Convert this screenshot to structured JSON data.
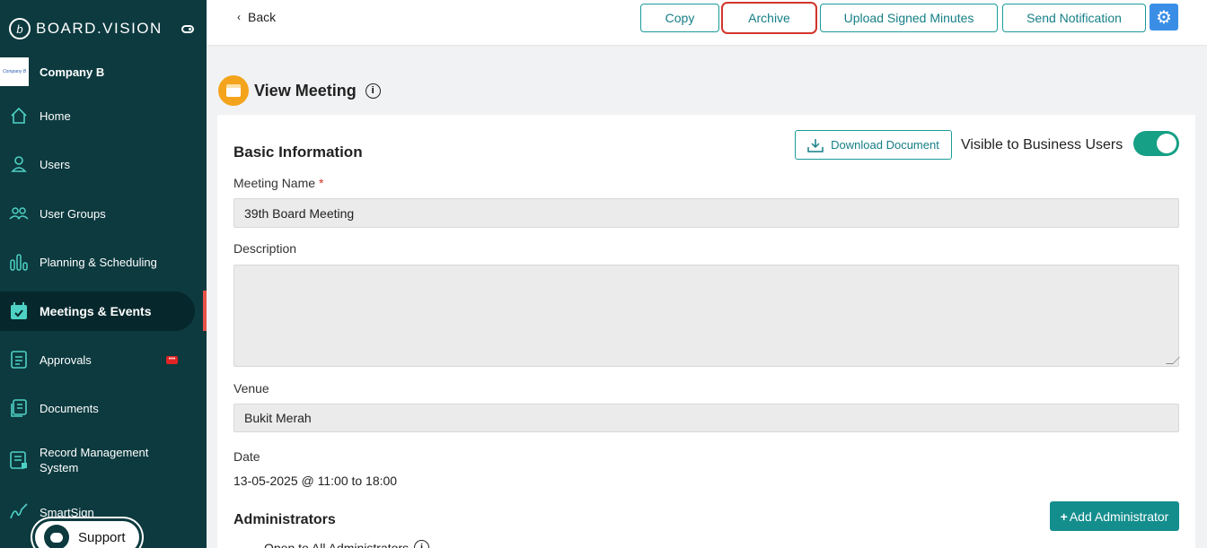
{
  "brand": {
    "name": "BOARD.VISION"
  },
  "company": {
    "logo_text": "Company B",
    "name": "Company B"
  },
  "sidebar": {
    "items": [
      {
        "label": "Home",
        "icon": "home-icon"
      },
      {
        "label": "Users",
        "icon": "user-icon"
      },
      {
        "label": "User Groups",
        "icon": "user-group-icon"
      },
      {
        "label": "Planning & Scheduling",
        "icon": "bar-chart-icon"
      },
      {
        "label": "Meetings & Events",
        "icon": "calendar-check-icon",
        "active": true
      },
      {
        "label": "Approvals",
        "icon": "document-list-icon",
        "badge": "•••"
      },
      {
        "label": "Documents",
        "icon": "documents-icon"
      },
      {
        "label": "Record Management System",
        "icon": "record-icon"
      },
      {
        "label": "SmartSign",
        "icon": "signature-icon"
      }
    ],
    "support_label": "Support"
  },
  "topbar": {
    "back_label": "Back",
    "buttons": [
      "Copy",
      "Archive",
      "Upload Signed Minutes",
      "Send Notification"
    ]
  },
  "page": {
    "title": "View Meeting"
  },
  "basic_info": {
    "title": "Basic Information",
    "download_label": "Download Document",
    "visible_label": "Visible to Business Users",
    "visible_on": true,
    "meeting_name_label": "Meeting Name",
    "meeting_name_required": "*",
    "meeting_name_value": "39th Board Meeting",
    "description_label": "Description",
    "description_value": "",
    "venue_label": "Venue",
    "venue_value": "Bukit Merah",
    "date_label": "Date",
    "date_value": "13-05-2025 @ 11:00 to 18:00"
  },
  "administrators": {
    "title": "Administrators",
    "add_label": "Add Administrator",
    "open_label": "Open to All Administrators"
  },
  "colors": {
    "sidebar": "#0c3a3f",
    "accent": "#148d8d",
    "archive_highlight": "#d1352b",
    "toggle_on": "#16a085"
  }
}
